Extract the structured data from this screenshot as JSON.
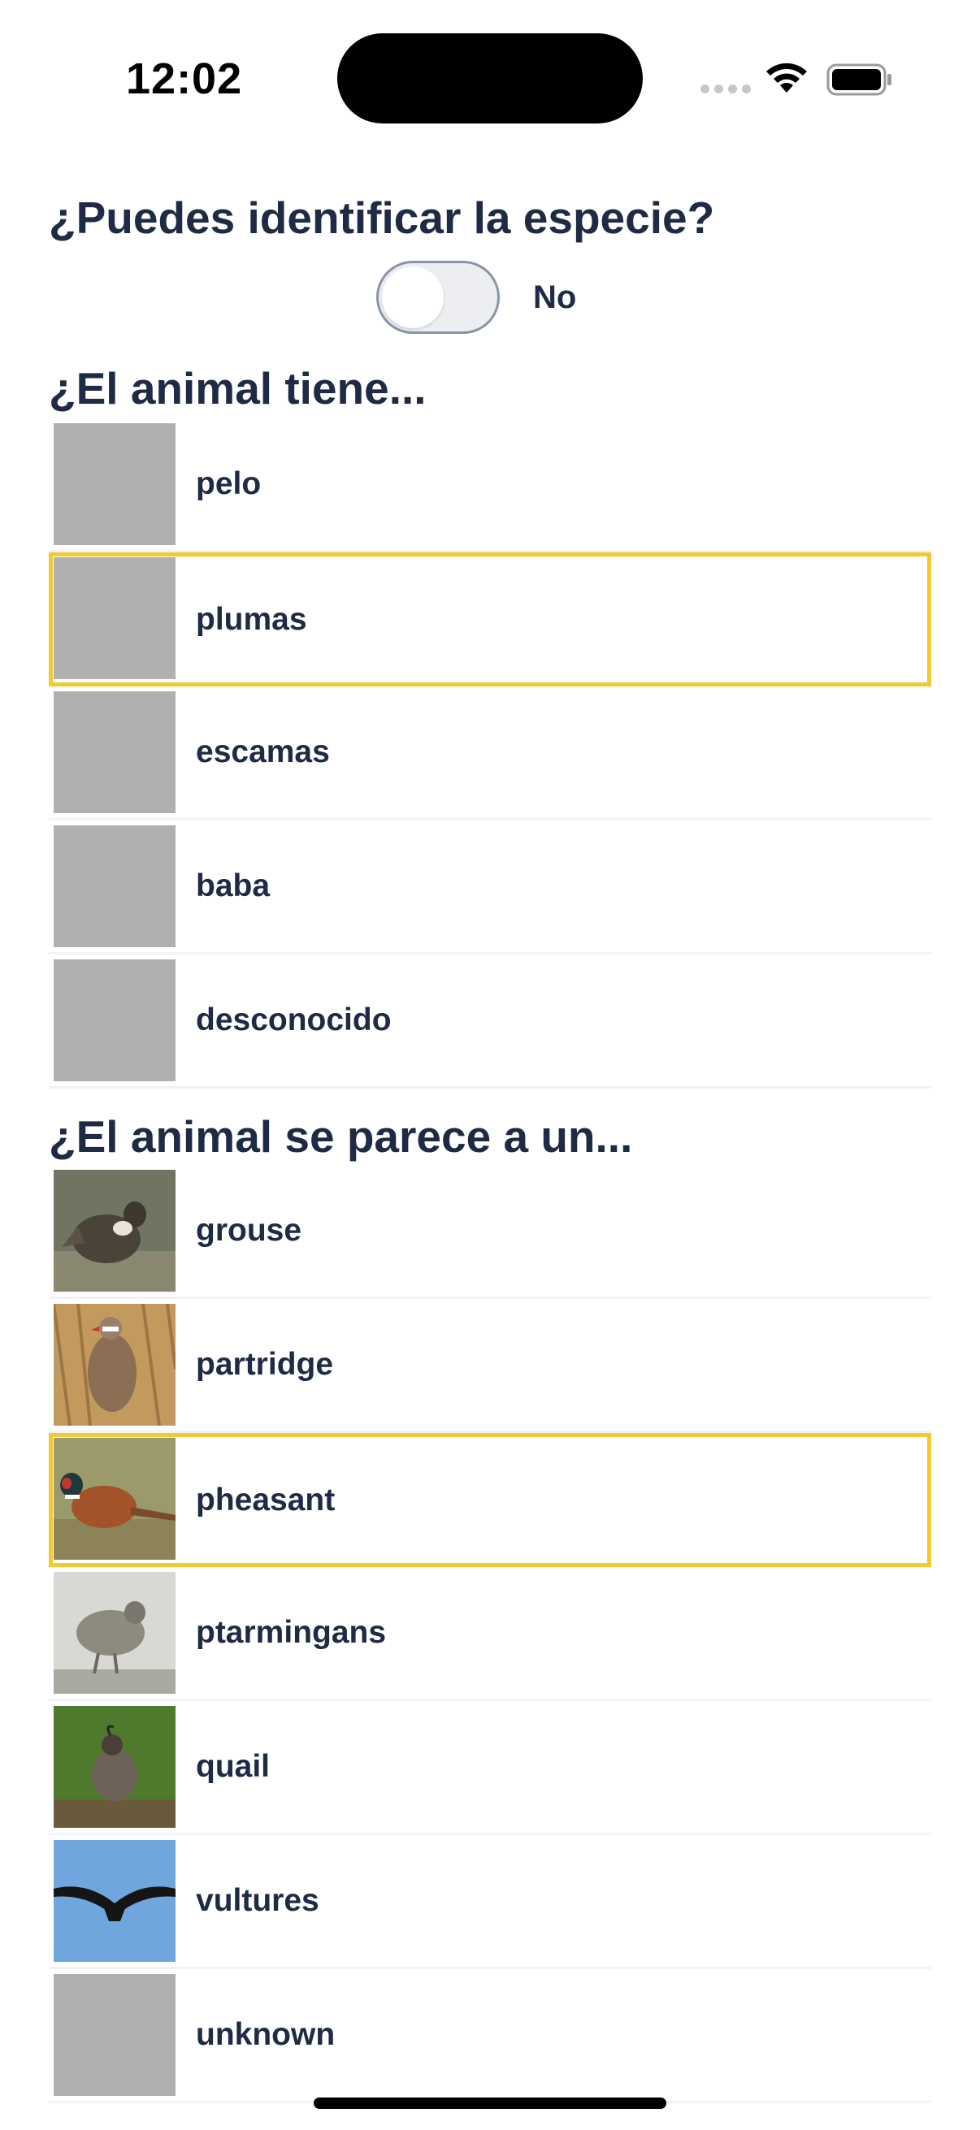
{
  "status_bar": {
    "time": "12:02"
  },
  "identify_question": {
    "title": "¿Puedes identificar la especie?",
    "toggle_state": "off",
    "toggle_label": "No"
  },
  "covering_section": {
    "title": "¿El animal tiene...",
    "options": [
      {
        "label": "pelo",
        "selected": false,
        "thumb": "gray-placeholder"
      },
      {
        "label": "plumas",
        "selected": true,
        "thumb": "gray-placeholder"
      },
      {
        "label": "escamas",
        "selected": false,
        "thumb": "gray-placeholder"
      },
      {
        "label": "baba",
        "selected": false,
        "thumb": "gray-placeholder"
      },
      {
        "label": "desconocido",
        "selected": false,
        "thumb": "gray-placeholder"
      }
    ]
  },
  "resemblance_section": {
    "title": "¿El animal se parece a un...",
    "options": [
      {
        "label": "grouse",
        "selected": false,
        "thumb": "grouse-photo"
      },
      {
        "label": "partridge",
        "selected": false,
        "thumb": "partridge-photo"
      },
      {
        "label": "pheasant",
        "selected": true,
        "thumb": "pheasant-photo"
      },
      {
        "label": "ptarmingans",
        "selected": false,
        "thumb": "ptarmigan-photo"
      },
      {
        "label": "quail",
        "selected": false,
        "thumb": "quail-photo"
      },
      {
        "label": "vultures",
        "selected": false,
        "thumb": "vulture-photo"
      },
      {
        "label": "unknown",
        "selected": false,
        "thumb": "gray-placeholder"
      }
    ]
  },
  "colors": {
    "text": "#1f2a44",
    "selected_border": "#f2c933",
    "placeholder": "#b0b0b0",
    "divider": "#f1f3f6"
  }
}
